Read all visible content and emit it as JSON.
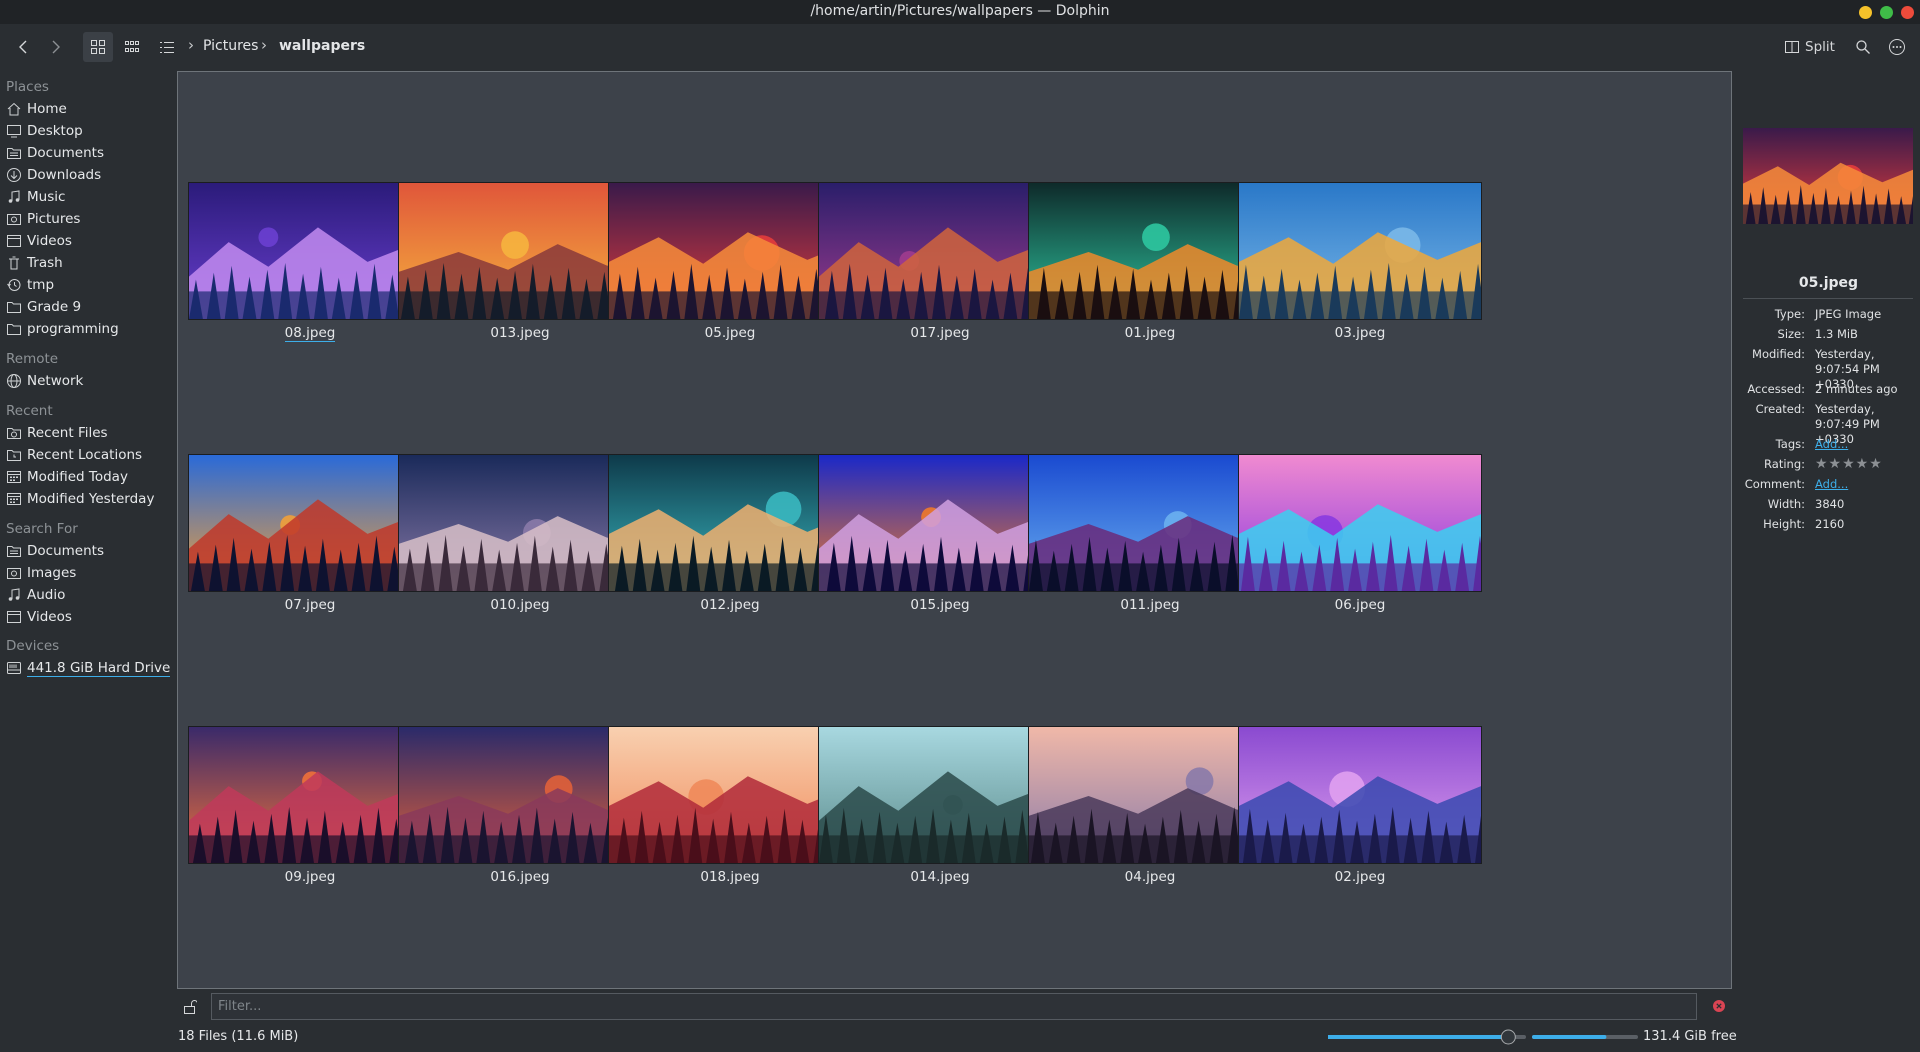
{
  "window": {
    "title": "/home/artin/Pictures/wallpapers — Dolphin",
    "colors": {
      "minimize": "#f6c22a",
      "maximize": "#3fbd48",
      "close": "#ee4b3b"
    }
  },
  "toolbar": {
    "back_icon": "arrow-left-icon",
    "forward_icon": "arrow-right-icon",
    "view_modes": [
      "icons-view-icon",
      "compact-view-icon",
      "details-view-icon"
    ],
    "breadcrumb": [
      "Pictures",
      "wallpapers"
    ],
    "split_label": "Split",
    "search_icon": "search-icon",
    "menu_icon": "hamburger-menu-icon"
  },
  "sidebar": {
    "places_header": "Places",
    "places": [
      {
        "label": "Home",
        "icon": "home-icon"
      },
      {
        "label": "Desktop",
        "icon": "desktop-icon"
      },
      {
        "label": "Documents",
        "icon": "folder-documents-icon"
      },
      {
        "label": "Downloads",
        "icon": "downloads-icon"
      },
      {
        "label": "Music",
        "icon": "music-icon"
      },
      {
        "label": "Pictures",
        "icon": "pictures-icon"
      },
      {
        "label": "Videos",
        "icon": "videos-icon"
      },
      {
        "label": "Trash",
        "icon": "trash-icon"
      },
      {
        "label": "tmp",
        "icon": "history-icon"
      },
      {
        "label": "Grade 9",
        "icon": "folder-icon"
      },
      {
        "label": "programming",
        "icon": "folder-icon"
      }
    ],
    "remote_header": "Remote",
    "remote": [
      {
        "label": "Network",
        "icon": "network-icon"
      }
    ],
    "recent_header": "Recent",
    "recent": [
      {
        "label": "Recent Files",
        "icon": "recent-files-icon"
      },
      {
        "label": "Recent Locations",
        "icon": "recent-locations-icon"
      },
      {
        "label": "Modified Today",
        "icon": "calendar-icon"
      },
      {
        "label": "Modified Yesterday",
        "icon": "calendar-icon"
      }
    ],
    "search_header": "Search For",
    "search": [
      {
        "label": "Documents",
        "icon": "folder-documents-icon"
      },
      {
        "label": "Images",
        "icon": "images-icon"
      },
      {
        "label": "Audio",
        "icon": "audio-icon"
      },
      {
        "label": "Videos",
        "icon": "videos-icon"
      }
    ],
    "devices_header": "Devices",
    "devices": [
      {
        "label": "441.8 GiB Hard Drive",
        "icon": "hard-drive-icon"
      }
    ]
  },
  "files": [
    {
      "name": "08.jpeg",
      "palette": [
        "#2b1b7a",
        "#6a3fd0",
        "#c28bf0",
        "#1a2a6e"
      ]
    },
    {
      "name": "013.jpeg",
      "palette": [
        "#e0563a",
        "#f6b43e",
        "#8a3a3a",
        "#141c2a"
      ]
    },
    {
      "name": "05.jpeg",
      "palette": [
        "#3a1a4a",
        "#e43c3c",
        "#f78c3a",
        "#1c1430"
      ]
    },
    {
      "name": "017.jpeg",
      "palette": [
        "#2a1e6a",
        "#a03c8e",
        "#d0643c",
        "#1a1640"
      ]
    },
    {
      "name": "01.jpeg",
      "palette": [
        "#0e2a2a",
        "#2ec7a0",
        "#f08a2a",
        "#1a0e10"
      ]
    },
    {
      "name": "03.jpeg",
      "palette": [
        "#2a78c8",
        "#7ab8e8",
        "#f0a83a",
        "#1a3a5a"
      ]
    },
    {
      "name": "07.jpeg",
      "palette": [
        "#2a6ad8",
        "#f0a03a",
        "#c0382a",
        "#0e1230"
      ]
    },
    {
      "name": "010.jpeg",
      "palette": [
        "#1a2a5a",
        "#8a7aa8",
        "#d8c0c8",
        "#3a2a3a"
      ]
    },
    {
      "name": "012.jpeg",
      "palette": [
        "#0e3a4a",
        "#3ab8c0",
        "#f0b070",
        "#0a1a24"
      ]
    },
    {
      "name": "015.jpeg",
      "palette": [
        "#1a28c8",
        "#f07a2a",
        "#d0a0e0",
        "#0e0a3a"
      ]
    },
    {
      "name": "011.jpeg",
      "palette": [
        "#1a4ad0",
        "#6ab0f0",
        "#6a2a7a",
        "#0a0e2a"
      ]
    },
    {
      "name": "06.jpeg",
      "palette": [
        "#f08ad0",
        "#8a3ae0",
        "#3ad0f0",
        "#5a2aa0"
      ]
    },
    {
      "name": "09.jpeg",
      "palette": [
        "#3a2a6a",
        "#f0703a",
        "#c03a5a",
        "#1a0e2a"
      ]
    },
    {
      "name": "016.jpeg",
      "palette": [
        "#2a2a6a",
        "#e0603a",
        "#8a3a5a",
        "#1a1430"
      ]
    },
    {
      "name": "018.jpeg",
      "palette": [
        "#f8d0b0",
        "#f08a5a",
        "#b02a3a",
        "#4a0e1a"
      ]
    },
    {
      "name": "014.jpeg",
      "palette": [
        "#a8d8e0",
        "#5a8a8a",
        "#2a4a4a",
        "#1a2a2a"
      ]
    },
    {
      "name": "04.jpeg",
      "palette": [
        "#f0b8a8",
        "#8a7aa8",
        "#4a3a5a",
        "#1a1424"
      ]
    },
    {
      "name": "02.jpeg",
      "palette": [
        "#8a4ad0",
        "#e0a0f0",
        "#3a4ab0",
        "#1a1a4a"
      ]
    }
  ],
  "selected_file": "08.jpeg",
  "info_panel": {
    "name": "05.jpeg",
    "rows": [
      {
        "label": "Type:",
        "value": "JPEG Image"
      },
      {
        "label": "Size:",
        "value": "1.3 MiB"
      },
      {
        "label": "Modified:",
        "value": "Yesterday, 9:07:54 PM +0330"
      },
      {
        "label": "Accessed:",
        "value": "2 minutes ago"
      },
      {
        "label": "Created:",
        "value": "Yesterday, 9:07:49 PM +0330"
      },
      {
        "label": "Tags:",
        "value": "Add..."
      },
      {
        "label": "Rating:",
        "value": "★★★★★"
      },
      {
        "label": "Comment:",
        "value": "Add..."
      },
      {
        "label": "Width:",
        "value": "3840"
      },
      {
        "label": "Height:",
        "value": "2160"
      }
    ],
    "rating": 0
  },
  "filter": {
    "placeholder": "Filter..."
  },
  "status": {
    "summary": "18 Files (11.6 MiB)",
    "free_space": "131.4 GiB free",
    "zoom_level": 0.92,
    "disk_used_fraction": 0.69
  },
  "accent": "#3daee9"
}
